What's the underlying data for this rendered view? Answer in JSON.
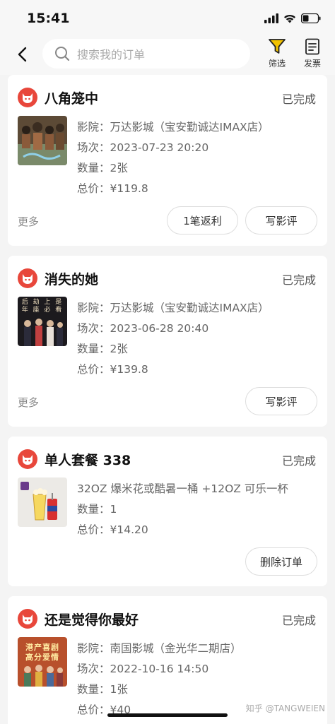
{
  "status_bar": {
    "time": "15:41"
  },
  "header": {
    "search_placeholder": "搜索我的订单",
    "filter_label": "筛选",
    "invoice_label": "发票"
  },
  "orders": [
    {
      "title": "八角笼中",
      "status": "已完成",
      "cinema": "影院：万达影城（宝安勤诚达IMAX店）",
      "session": "场次：2023-07-23 20:20",
      "quantity": "数量：2张",
      "total": "总价：¥119.8",
      "more": "更多",
      "buttons": [
        "1笔返利",
        "写影评"
      ]
    },
    {
      "title": "消失的她",
      "status": "已完成",
      "cinema": "影院：万达影城（宝安勤诚达IMAX店）",
      "session": "场次：2023-06-28 20:40",
      "quantity": "数量：2张",
      "total": "总价：¥139.8",
      "more": "更多",
      "buttons": [
        "写影评"
      ],
      "poster_text": "后 劫 上 是 年 座 必 看"
    },
    {
      "title": "单人套餐 338",
      "status": "已完成",
      "item": "32OZ 爆米花或酷暑一桶 +12OZ 可乐一杯",
      "quantity": "数量：1",
      "total": "总价：¥14.20",
      "buttons": [
        "删除订单"
      ]
    },
    {
      "title": "还是觉得你最好",
      "status": "已完成",
      "cinema": "影院：南国影城（金光华二期店）",
      "session": "场次：2022-10-16 14:50",
      "quantity": "数量：1张",
      "total": "总价：¥40",
      "poster_text": "港产喜剧 高分爱情"
    }
  ],
  "watermark": "知乎 @TANGWEIEN",
  "colors": {
    "brand": "#e8473b",
    "filter_icon": "#f2c200"
  }
}
